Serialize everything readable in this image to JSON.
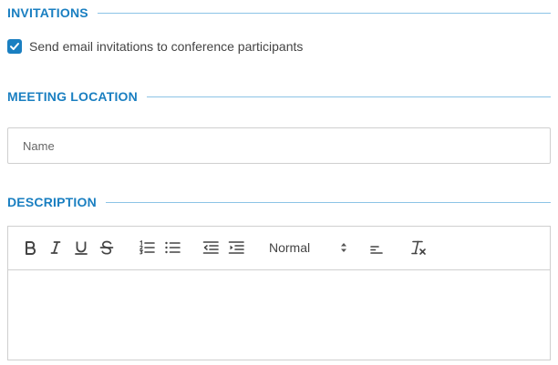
{
  "invitations": {
    "title": "INVITATIONS",
    "checkbox_label": "Send email invitations to conference participants",
    "checked": true
  },
  "meeting_location": {
    "title": "MEETING LOCATION",
    "name_placeholder": "Name",
    "name_value": ""
  },
  "description": {
    "title": "DESCRIPTION",
    "toolbar": {
      "format_value": "Normal",
      "icons": [
        "bold-icon",
        "italic-icon",
        "underline-icon",
        "strikethrough-icon",
        "ordered-list-icon",
        "bullet-list-icon",
        "outdent-icon",
        "indent-icon",
        "align-icon",
        "clear-format-icon"
      ]
    },
    "body_text": ""
  },
  "colors": {
    "accent": "#1a7fc1",
    "divider": "#8cc4e6",
    "border": "#cfcfcf"
  }
}
